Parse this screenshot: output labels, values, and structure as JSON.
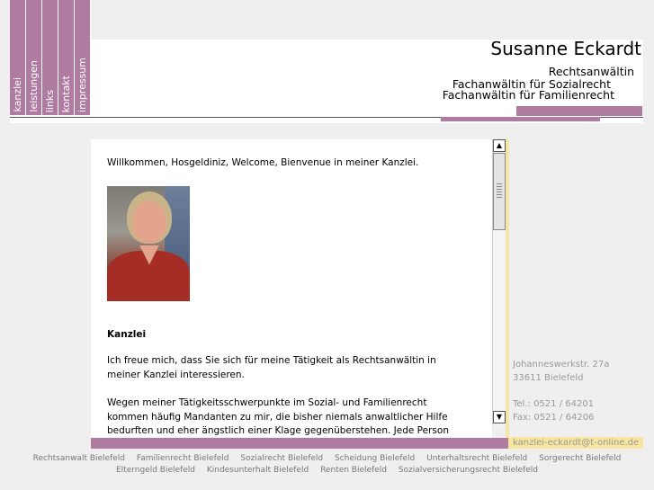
{
  "nav": {
    "items": [
      {
        "label": "kanzlei"
      },
      {
        "label": "leistungen"
      },
      {
        "label": "links"
      },
      {
        "label": "kontakt"
      },
      {
        "label": "impressum"
      }
    ]
  },
  "header": {
    "name": "Susanne Eckardt",
    "line1": "Rechtsanwältin",
    "line2": "Fachanwältin für Sozialrecht",
    "line3": "Fachanwältin für Familienrecht"
  },
  "content": {
    "welcome": "Willkommen, Hosgeldiniz, Welcome, Bienvenue in meiner Kanzlei.",
    "section_title": "Kanzlei",
    "para1": "Ich freue mich, dass Sie sich für meine Tätigkeit als Rechtsanwältin in meiner Kanzlei interessieren.",
    "para2": "Wegen meiner Tätigkeitsschwerpunkte im Sozial- und Familienrecht kommen häufig Mandanten zu mir, die bisher niemals anwaltlicher Hilfe bedurften und eher ängstlich einer Klage gegenüberstehen. Jede Person hat aber das Recht sich"
  },
  "scrollbar": {
    "up_glyph": "▲",
    "down_glyph": "▼"
  },
  "address": {
    "street": "Johanneswerkstr. 27a",
    "city": "33611 Bielefeld",
    "tel": "Tel.: 0521 / 64201",
    "fax": "Fax: 0521 / 64206",
    "email": "kanzlei-eckardt@t-online.de"
  },
  "footer": {
    "row1": [
      "Rechtsanwalt Bielefeld",
      "Familienrecht Bielefeld",
      "Sozialrecht Bielefeld",
      "Scheidung Bielefeld",
      "Unterhaltsrecht Bielefeld",
      "Sorgerecht Bielefeld"
    ],
    "row2": [
      "Elterngeld Bielefeld",
      "Kindesunterhalt Bielefeld",
      "Renten Bielefeld",
      "Sozialversicherungsrecht Bielefeld"
    ]
  },
  "colors": {
    "accent_mauve": "#b07ba0",
    "accent_yellow": "#f8e6a0",
    "address_gray": "#999999"
  }
}
